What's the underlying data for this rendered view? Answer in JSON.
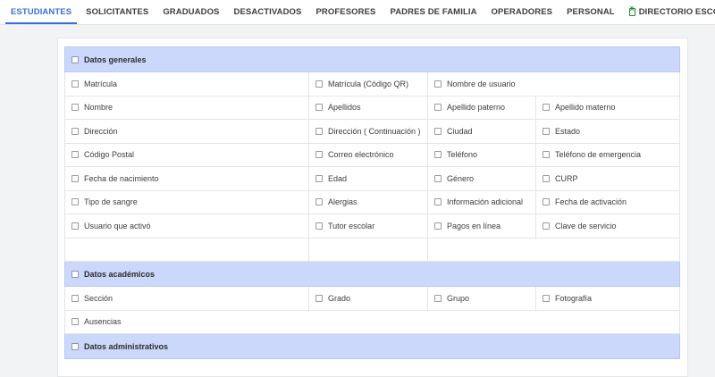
{
  "tabs": [
    {
      "label": "ESTUDIANTES",
      "active": true
    },
    {
      "label": "SOLICITANTES"
    },
    {
      "label": "GRADUADOS"
    },
    {
      "label": "DESACTIVADOS"
    },
    {
      "label": "PROFESORES"
    },
    {
      "label": "PADRES DE FAMILIA"
    },
    {
      "label": "OPERADORES"
    },
    {
      "label": "PERSONAL"
    },
    {
      "label": "DIRECTORIO ESCOLAR",
      "icon": "excel-file-icon"
    }
  ],
  "sections": {
    "general": {
      "title": "Datos generales",
      "fields": {
        "matricula": "Matrícula",
        "matricula_qr": "Matrícula (Código QR)",
        "usuario": "Nombre de usuario",
        "nombre": "Nombre",
        "apellidos": "Apellidos",
        "apellido_paterno": "Apellido paterno",
        "apellido_materno": "Apellido materno",
        "direccion": "Dirección",
        "direccion_cont": "Dirección ( Continuación )",
        "ciudad": "Ciudad",
        "estado": "Estado",
        "cp": "Código Postal",
        "correo": "Correo electrónico",
        "telefono": "Teléfono",
        "tel_emergencia": "Teléfono de emergencia",
        "fecha_nac": "Fecha de nacimiento",
        "edad": "Edad",
        "genero": "Género",
        "curp": "CURP",
        "sangre": "Tipo de sangre",
        "alergias": "Alergias",
        "info_adicional": "Información adicional",
        "fecha_activacion": "Fecha de activación",
        "usuario_activo": "Usuario que activó",
        "tutor": "Tutor escolar",
        "pagos": "Pagos en línea",
        "clave": "Clave de servicio"
      }
    },
    "academic": {
      "title": "Datos académicos",
      "fields": {
        "seccion": "Sección",
        "grado": "Grado",
        "grupo": "Grupo",
        "fotografia": "Fotografía",
        "ausencias": "Ausencias"
      }
    },
    "admin": {
      "title": "Datos administrativos"
    }
  },
  "colors": {
    "accent": "#3b6fd8",
    "section_bg": "#ccd8fb"
  }
}
